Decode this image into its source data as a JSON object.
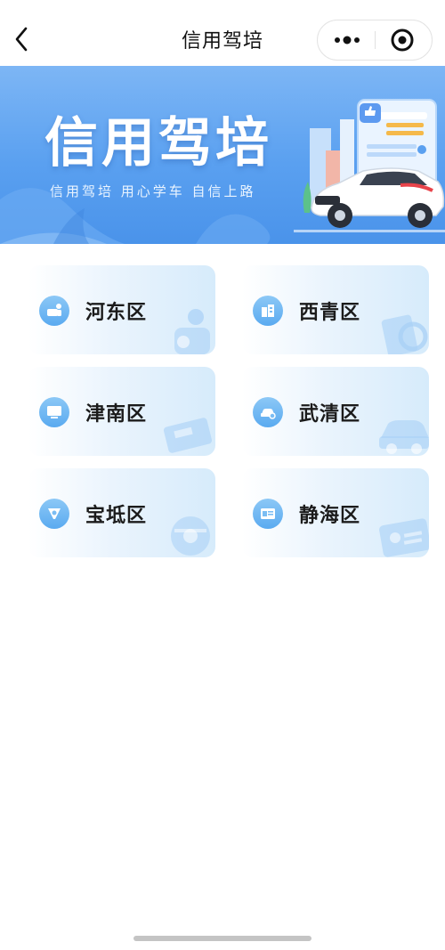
{
  "nav": {
    "title": "信用驾培"
  },
  "banner": {
    "title": "信用驾培",
    "subtitle": "信用驾培 用心学车 自信上路"
  },
  "districts": [
    {
      "label": "河东区",
      "icon": "car-person-icon",
      "deco": "person-deco-icon"
    },
    {
      "label": "西青区",
      "icon": "building-icon",
      "deco": "steering-doc-deco-icon"
    },
    {
      "label": "津南区",
      "icon": "monitor-icon",
      "deco": "truck-deco-icon"
    },
    {
      "label": "武清区",
      "icon": "car-icon",
      "deco": "car-deco-icon"
    },
    {
      "label": "宝坻区",
      "icon": "steering-wheel-icon",
      "deco": "steering-wheel-deco-icon"
    },
    {
      "label": "静海区",
      "icon": "id-card-icon",
      "deco": "id-card-deco-icon"
    }
  ],
  "colors": {
    "accent": "#4a93ea",
    "card_icon": "#5aaaf0"
  }
}
